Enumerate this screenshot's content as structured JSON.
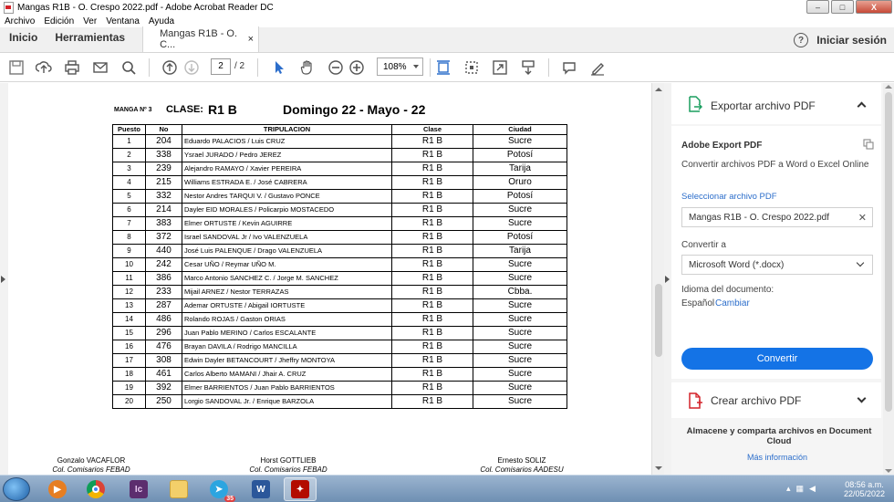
{
  "window": {
    "title": "Mangas R1B - O. Crespo 2022.pdf - Adobe Acrobat Reader DC",
    "min_label": "–",
    "max_label": "□",
    "close_label": "X"
  },
  "menu": [
    "Archivo",
    "Edición",
    "Ver",
    "Ventana",
    "Ayuda"
  ],
  "tabs": {
    "home": "Inicio",
    "tools": "Herramientas",
    "doc": "Mangas R1B - O. C...",
    "doc_close": "×",
    "signin": "Iniciar sesión",
    "help": "?"
  },
  "toolbar": {
    "page_current": "2",
    "page_total": "/ 2",
    "zoom": "108%"
  },
  "document": {
    "manga": "MANGA Nº 3",
    "clase_label": "CLASE:",
    "clase_value": "R1 B",
    "date": "Domingo 22 - Mayo - 22",
    "headers": [
      "Puesto",
      "No",
      "TRIPULACION",
      "Clase",
      "Ciudad"
    ],
    "rows": [
      [
        "1",
        "204",
        "Eduardo PALACIOS / Luis CRUZ",
        "R1 B",
        "Sucre"
      ],
      [
        "2",
        "338",
        "Ysrael JURADO / Pedro JEREZ",
        "R1 B",
        "Potosí"
      ],
      [
        "3",
        "239",
        "Alejandro RAMAYO / Xavier PEREIRA",
        "R1 B",
        "Tarija"
      ],
      [
        "4",
        "215",
        "Williams ESTRADA E. / José CABRERA",
        "R1 B",
        "Oruro"
      ],
      [
        "5",
        "332",
        "Nestor Andres TARQUI V. / Gustavo PONCE",
        "R1 B",
        "Potosí"
      ],
      [
        "6",
        "214",
        "Dayler EID MORALES / Policarpio MOSTACEDO",
        "R1 B",
        "Sucre"
      ],
      [
        "7",
        "383",
        "Elmer ORTUSTE / Kevin AGUIRRE",
        "R1 B",
        "Sucre"
      ],
      [
        "8",
        "372",
        "Israel SANDOVAL Jr / Ivo VALENZUELA",
        "R1 B",
        "Potosí"
      ],
      [
        "9",
        "440",
        "José Luis PALENQUE / Drago VALENZUELA",
        "R1 B",
        "Tarija"
      ],
      [
        "10",
        "242",
        "Cesar UÑO / Reymar UÑO M.",
        "R1 B",
        "Sucre"
      ],
      [
        "11",
        "386",
        "Marco Antonio SANCHEZ C. / Jorge M. SANCHEZ",
        "R1 B",
        "Sucre"
      ],
      [
        "12",
        "233",
        "Mijail ARNEZ / Nestor TERRAZAS",
        "R1 B",
        "Cbba."
      ],
      [
        "13",
        "287",
        "Ademar ORTUSTE / Abigail IORTUSTE",
        "R1 B",
        "Sucre"
      ],
      [
        "14",
        "486",
        "Rolando ROJAS / Gaston ORIAS",
        "R1 B",
        "Sucre"
      ],
      [
        "15",
        "296",
        "Juan Pablo MERINO / Carlos ESCALANTE",
        "R1 B",
        "Sucre"
      ],
      [
        "16",
        "476",
        "Brayan DAVILA / Rodrigo MANCILLA",
        "R1 B",
        "Sucre"
      ],
      [
        "17",
        "308",
        "Edwin Dayler BETANCOURT / Jheffry MONTOYA",
        "R1 B",
        "Sucre"
      ],
      [
        "18",
        "461",
        "Carlos Alberto MAMANI / Jhair A. CRUZ",
        "R1 B",
        "Sucre"
      ],
      [
        "19",
        "392",
        "Elmer BARRIENTOS / Juan Pablo BARRIENTOS",
        "R1 B",
        "Sucre"
      ],
      [
        "20",
        "250",
        "Lorgio SANDOVAL Jr. / Enrique BARZOLA",
        "R1 B",
        "Sucre"
      ]
    ],
    "signatures": [
      {
        "name": "Gonzalo VACAFLOR",
        "role": "Col.  Comisarios FEBAD"
      },
      {
        "name": "Horst GOTTLIEB",
        "role": "Col.  Comisarios FEBAD"
      },
      {
        "name": "Ernesto SOLIZ",
        "role": "Col.  Comisarios AADESU"
      }
    ]
  },
  "panel": {
    "export_title": "Exportar archivo PDF",
    "adobe_export": "Adobe Export PDF",
    "description": "Convertir archivos PDF a Word o Excel Online",
    "select_label": "Seleccionar archivo PDF",
    "selected_file": "Mangas R1B - O. Crespo 2022.pdf",
    "clear": "✕",
    "convert_to_label": "Convertir a",
    "convert_to_value": "Microsoft Word (*.docx)",
    "lang_label": "Idioma del documento:",
    "lang_value": "Español",
    "lang_change": "Cambiar",
    "convert_button": "Convertir",
    "create_title": "Crear archivo PDF",
    "cloud_text": "Almacene y comparta archivos en Document Cloud",
    "more_info": "Más información"
  },
  "taskbar": {
    "time": "08:56 a.m.",
    "date": "22/05/2022",
    "telegram_badge": "35",
    "ic_label": "Ic",
    "word_label": "W"
  },
  "colors": {
    "accent": "#1473e6",
    "adobe_red": "#d4232a",
    "link": "#2c6ecb"
  }
}
